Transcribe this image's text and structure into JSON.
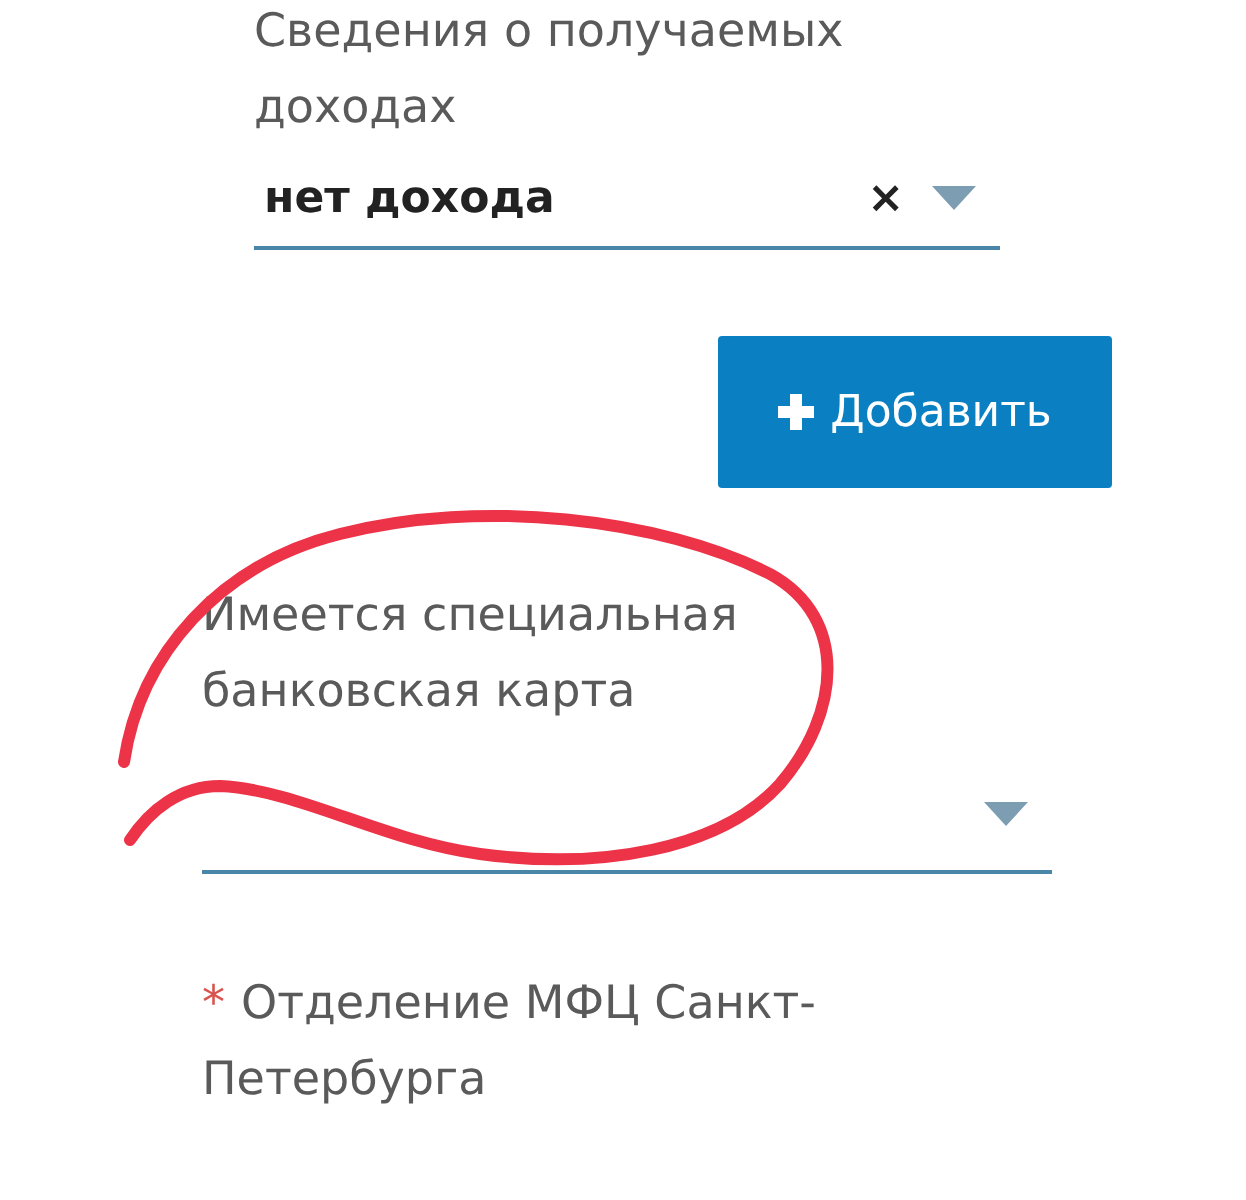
{
  "income_field": {
    "label": "Сведения о получаемых доходах",
    "value": "нет дохода",
    "clear": "×"
  },
  "add_button": {
    "label": "Добавить"
  },
  "card_field": {
    "label": "Имеется специальная банковская карта"
  },
  "office_field": {
    "required_mark": "*",
    "label": "Отделение МФЦ Санкт-Петербурга"
  }
}
